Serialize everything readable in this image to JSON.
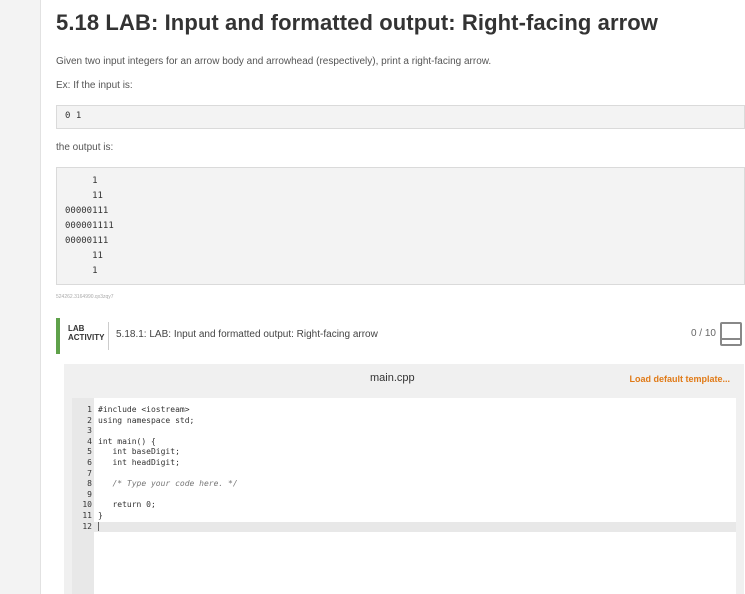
{
  "title": "5.18 LAB: Input and formatted output: Right-facing arrow",
  "description": "Given two input integers for an arrow body and arrowhead (respectively), print a right-facing arrow.",
  "example_label": "Ex: If the input is:",
  "input_example": "0 1",
  "output_label": "the output is:",
  "output_lines": [
    "     1",
    "     11",
    "00000111",
    "000001111",
    "00000111",
    "     11",
    "     1"
  ],
  "hash_text": "524262.3164990.qx3zqy7",
  "lab": {
    "type_line1": "LAB",
    "type_line2": "ACTIVITY",
    "name": "5.18.1: LAB: Input and formatted output: Right-facing arrow",
    "score": "0 / 10"
  },
  "editor": {
    "file_name": "main.cpp",
    "load_template": "Load default template...",
    "lines": [
      {
        "num": "1",
        "text": "#include <iostream>"
      },
      {
        "num": "2",
        "text": "using namespace std;"
      },
      {
        "num": "3",
        "text": ""
      },
      {
        "num": "4",
        "text": "int main() {"
      },
      {
        "num": "5",
        "text": "   int baseDigit;"
      },
      {
        "num": "6",
        "text": "   int headDigit;"
      },
      {
        "num": "7",
        "text": ""
      },
      {
        "num": "8",
        "text": "   /* Type your code here. */"
      },
      {
        "num": "9",
        "text": ""
      },
      {
        "num": "10",
        "text": "   return 0;"
      },
      {
        "num": "11",
        "text": "}"
      },
      {
        "num": "12",
        "text": ""
      }
    ]
  },
  "colors": {
    "lab_accent": "#5fa14a",
    "link": "#e07a17"
  }
}
